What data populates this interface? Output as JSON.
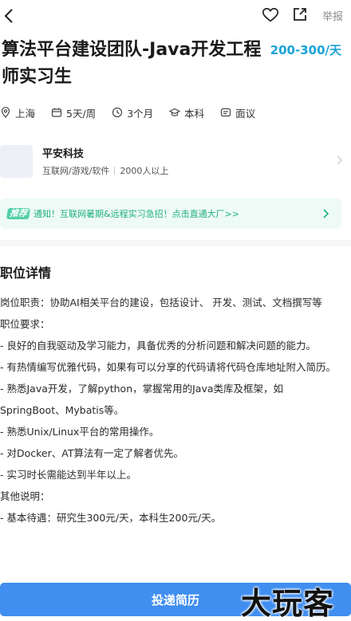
{
  "header": {
    "report_label": "举报"
  },
  "job": {
    "title": "算法平台建设团队-Java开发工程师实习生",
    "salary": "200-300/天",
    "tags": [
      {
        "icon": "location-icon",
        "label": "上海"
      },
      {
        "icon": "calendar-icon",
        "label": "5天/周"
      },
      {
        "icon": "clock-icon",
        "label": "3个月"
      },
      {
        "icon": "graduation-cap-icon",
        "label": "本科"
      },
      {
        "icon": "chat-icon",
        "label": "面议"
      }
    ]
  },
  "company": {
    "name": "平安科技",
    "industry": "互联网/游戏/软件",
    "size": "2000人以上"
  },
  "banner": {
    "badge": "推荐",
    "text": "通知！互联网暑期&远程实习急招！点击直通大厂>>"
  },
  "details": {
    "title": "职位详情",
    "lines": [
      "岗位职责：协助AI相关平台的建设，包括设计、 开发、测试、文档撰写等",
      "职位要求：",
      "- 良好的自我驱动及学习能力，具备优秀的分析问题和解决问题的能力。",
      "- 有热情编写优雅代码，如果有可以分享的代码请将代码仓库地址附入简历。",
      "- 熟悉Java开发，了解python，掌握常用的Java类库及框架，如SpringBoot、Mybatis等。",
      "- 熟悉Unix/Linux平台的常用操作。",
      "- 对Docker、AT算法有一定了解者优先。",
      "- 实习时长需能达到半年以上。",
      "其他说明：",
      "- 基本待遇：研究生300元/天，本科生200元/天。"
    ]
  },
  "actions": {
    "apply_label": "投递简历"
  },
  "watermark": "大玩客"
}
